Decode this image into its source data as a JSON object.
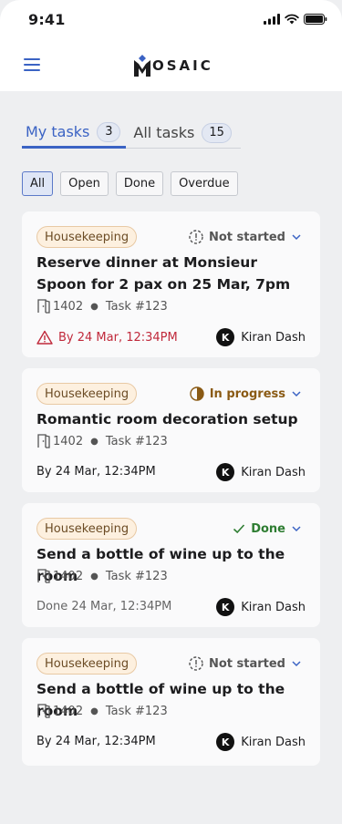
{
  "status_bar": {
    "time": "9:41"
  },
  "header": {
    "logo_text": "OSAIC",
    "menu_icon": "hamburger-icon"
  },
  "tabs": [
    {
      "label": "My tasks",
      "count": "3",
      "active": true
    },
    {
      "label": "All tasks",
      "count": "15",
      "active": false
    }
  ],
  "filters": [
    {
      "label": "All",
      "active": true
    },
    {
      "label": "Open",
      "active": false
    },
    {
      "label": "Done",
      "active": false
    },
    {
      "label": "Overdue",
      "active": false
    }
  ],
  "tasks": [
    {
      "category": "Housekeeping",
      "status": "Not started",
      "title": "Reserve dinner at Monsieur Spoon for 2 pax on 25 Mar, 7pm",
      "room": "1402",
      "task_id": "Task #123",
      "due": "By 24 Mar, 12:34PM",
      "assignee_initial": "K",
      "assignee": "Kiran Dash"
    },
    {
      "category": "Housekeeping",
      "status": "In progress",
      "title": "Romantic room decoration setup",
      "room": "1402",
      "task_id": "Task #123",
      "due": "By 24 Mar, 12:34PM",
      "assignee_initial": "K",
      "assignee": "Kiran Dash"
    },
    {
      "category": "Housekeeping",
      "status": "Done",
      "title": "Send a bottle of wine up to the room",
      "room": "1402",
      "task_id": "Task #123",
      "due": "Done 24 Mar, 12:34PM",
      "assignee_initial": "K",
      "assignee": "Kiran Dash"
    },
    {
      "category": "Housekeeping",
      "status": "Not started",
      "title": "Send a bottle of wine up to the room",
      "room": "1402",
      "task_id": "Task #123",
      "due": "By 24 Mar, 12:34PM",
      "assignee_initial": "K",
      "assignee": "Kiran Dash"
    }
  ],
  "colors": {
    "accent": "#3b63c4",
    "overdue": "#c0293b",
    "in_progress": "#8a5a14",
    "done": "#2e7d32",
    "not_started": "#555555"
  }
}
